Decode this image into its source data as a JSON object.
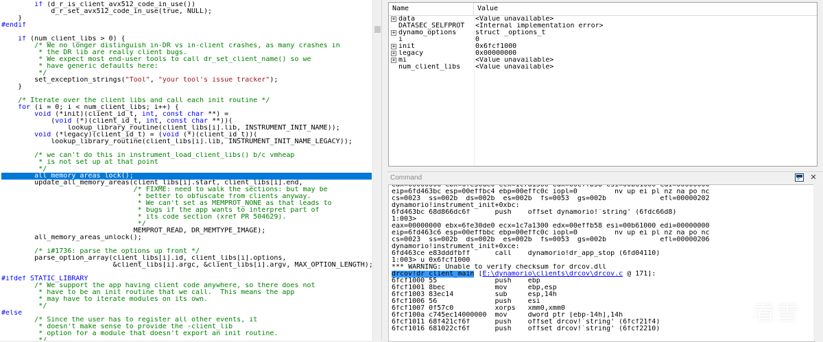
{
  "source": {
    "highlighted_line": 25,
    "lines": [
      [
        {
          "t": "        ",
          "c": "plain"
        },
        {
          "t": "if",
          "c": "kw"
        },
        {
          "t": " (d_r_is_client_avx512_code_in_use())",
          "c": "plain"
        }
      ],
      [
        {
          "t": "            d_r_set_avx512_code_in_use(true, NULL);",
          "c": "plain"
        }
      ],
      [
        {
          "t": "    }",
          "c": "plain"
        }
      ],
      [
        {
          "t": "#endif",
          "c": "pp"
        }
      ],
      [
        {
          "t": "",
          "c": "plain"
        }
      ],
      [
        {
          "t": "    ",
          "c": "plain"
        },
        {
          "t": "if",
          "c": "kw"
        },
        {
          "t": " (num_client_libs > 0) {",
          "c": "plain"
        }
      ],
      [
        {
          "t": "        /* We no longer distinguish in-DR vs in-client crashes, as many crashes in",
          "c": "com"
        }
      ],
      [
        {
          "t": "         * the DR lib are really client bugs.",
          "c": "com"
        }
      ],
      [
        {
          "t": "         * We expect most end-user tools to call dr_set_client_name() so we",
          "c": "com"
        }
      ],
      [
        {
          "t": "         * have generic defaults here:",
          "c": "com"
        }
      ],
      [
        {
          "t": "         */",
          "c": "com"
        }
      ],
      [
        {
          "t": "        set_exception_strings(",
          "c": "plain"
        },
        {
          "t": "\"Tool\"",
          "c": "str"
        },
        {
          "t": ", ",
          "c": "plain"
        },
        {
          "t": "\"your tool's issue tracker\"",
          "c": "str"
        },
        {
          "t": ");",
          "c": "plain"
        }
      ],
      [
        {
          "t": "    }",
          "c": "plain"
        }
      ],
      [
        {
          "t": "",
          "c": "plain"
        }
      ],
      [
        {
          "t": "    /* Iterate over the client libs and call each init routine */",
          "c": "com"
        }
      ],
      [
        {
          "t": "    ",
          "c": "plain"
        },
        {
          "t": "for",
          "c": "kw"
        },
        {
          "t": " (i = 0; i < num_client_libs; i++) {",
          "c": "plain"
        }
      ],
      [
        {
          "t": "        ",
          "c": "plain"
        },
        {
          "t": "void",
          "c": "kw"
        },
        {
          "t": " (*init)(client_id_t, ",
          "c": "plain"
        },
        {
          "t": "int",
          "c": "kw"
        },
        {
          "t": ", ",
          "c": "plain"
        },
        {
          "t": "const char",
          "c": "kw"
        },
        {
          "t": " **) =",
          "c": "plain"
        }
      ],
      [
        {
          "t": "            (",
          "c": "plain"
        },
        {
          "t": "void",
          "c": "kw"
        },
        {
          "t": " (*)(client_id_t, ",
          "c": "plain"
        },
        {
          "t": "int",
          "c": "kw"
        },
        {
          "t": ", ",
          "c": "plain"
        },
        {
          "t": "const char",
          "c": "kw"
        },
        {
          "t": " **))(",
          "c": "plain"
        }
      ],
      [
        {
          "t": "                lookup_library_routine(client_libs[i].lib, INSTRUMENT_INIT_NAME));",
          "c": "plain"
        }
      ],
      [
        {
          "t": "        ",
          "c": "plain"
        },
        {
          "t": "void",
          "c": "kw"
        },
        {
          "t": " (*legacy)(client_id_t) = (",
          "c": "plain"
        },
        {
          "t": "void",
          "c": "kw"
        },
        {
          "t": " (*)(client_id_t))(",
          "c": "plain"
        }
      ],
      [
        {
          "t": "            lookup_library_routine(client_libs[i].lib, INSTRUMENT_INIT_NAME_LEGACY));",
          "c": "plain"
        }
      ],
      [
        {
          "t": "",
          "c": "plain"
        }
      ],
      [
        {
          "t": "        /* we can't do this in instrument_load_client_libs() b/c vmheap",
          "c": "com"
        }
      ],
      [
        {
          "t": "         * is not set up at that point",
          "c": "com"
        }
      ],
      [
        {
          "t": "         */",
          "c": "com"
        }
      ],
      [
        {
          "t": "        all_memory_areas_lock();",
          "c": "plain"
        }
      ],
      [
        {
          "t": "        update_all_memory_areas(client_libs[i].start, client_libs[i].end,",
          "c": "plain"
        }
      ],
      [
        {
          "t": "                                /* FIXME: need to walk the sections: but may be",
          "c": "com"
        }
      ],
      [
        {
          "t": "                                 * better to obfuscate from clients anyway.",
          "c": "com"
        }
      ],
      [
        {
          "t": "                                 * We can't set as MEMPROT_NONE as that leads to",
          "c": "com"
        }
      ],
      [
        {
          "t": "                                 * bugs if the app wants to interpret part of",
          "c": "com"
        }
      ],
      [
        {
          "t": "                                 * its code section (xref PR 504629).",
          "c": "com"
        }
      ],
      [
        {
          "t": "                                 */",
          "c": "com"
        }
      ],
      [
        {
          "t": "                                MEMPROT_READ, DR_MEMTYPE_IMAGE);",
          "c": "plain"
        }
      ],
      [
        {
          "t": "        all_memory_areas_unlock();",
          "c": "plain"
        }
      ],
      [
        {
          "t": "",
          "c": "plain"
        }
      ],
      [
        {
          "t": "        /* i#1736: parse the options up front */",
          "c": "com"
        }
      ],
      [
        {
          "t": "        parse_option_array(client_libs[i].id, client_libs[i].options,",
          "c": "plain"
        }
      ],
      [
        {
          "t": "                           &client_libs[i].argc, &client_libs[i].argv, MAX_OPTION_LENGTH);",
          "c": "plain"
        }
      ],
      [
        {
          "t": "",
          "c": "plain"
        }
      ],
      [
        {
          "t": "#ifdef STATIC_LIBRARY",
          "c": "pp"
        }
      ],
      [
        {
          "t": "        /* We support the app having client code anywhere, so there does not",
          "c": "com"
        }
      ],
      [
        {
          "t": "         * have to be an init routine that we call.  This means the app",
          "c": "com"
        }
      ],
      [
        {
          "t": "         * may have to iterate modules on its own.",
          "c": "com"
        }
      ],
      [
        {
          "t": "         */",
          "c": "com"
        }
      ],
      [
        {
          "t": "#else",
          "c": "pp"
        }
      ],
      [
        {
          "t": "        /* Since the user has to register all other events, it",
          "c": "com"
        }
      ],
      [
        {
          "t": "         * doesn't make sense to provide the -client_lib",
          "c": "com"
        }
      ],
      [
        {
          "t": "         * option for a module that doesn't export an init routine.",
          "c": "com"
        }
      ],
      [
        {
          "t": "         */",
          "c": "com"
        }
      ]
    ]
  },
  "watch": {
    "header_name": "Name",
    "header_value": "Value",
    "rows": [
      {
        "expand": "+",
        "name": "data",
        "value": "<Value unavailable>"
      },
      {
        "expand": "",
        "name": "DATASEC_SELFPROT",
        "value": "<Internal implementation error>"
      },
      {
        "expand": "+",
        "name": "dynamo_options",
        "value": "struct _options_t"
      },
      {
        "expand": "",
        "name": "i",
        "value": "0"
      },
      {
        "expand": "+",
        "name": "init",
        "value": "0x6fcf1000"
      },
      {
        "expand": "+",
        "name": "legacy",
        "value": "0x00000000"
      },
      {
        "expand": "+",
        "name": "mi",
        "value": "<Value unavailable>"
      },
      {
        "expand": "",
        "name": "num_client_libs",
        "value": "<Value unavailable>"
      }
    ]
  },
  "command": {
    "title": "Command",
    "icon": "console-icon",
    "lines": [
      [
        {
          "t": "eax=00000000 ebx=6fe30de0 ecx=1c7a1300 edx=00effb58 esi=00b61000 edi=00000000"
        }
      ],
      [
        {
          "t": "eip=6fd463bc esp=00effbc4 ebp=00effc0c iopl=0         nv up ei pl nz na po nc"
        }
      ],
      [
        {
          "t": "cs=0023  ss=002b  ds=002b  es=002b  fs=0053  gs=002b             efl=00000202"
        }
      ],
      [
        {
          "t": "dynamorio!instrument_init+0xbc:"
        }
      ],
      [
        {
          "t": "6fd463bc 68d866dc6f      push    offset dynamorio!`string' (6fdc66d8)"
        }
      ],
      [
        {
          "t": "1:003>"
        }
      ],
      [
        {
          "t": "eax=00000000 ebx=6fe30de0 ecx=1c7a1300 edx=00effb58 esi=00b61000 edi=00000000"
        }
      ],
      [
        {
          "t": "eip=6fd463c6 esp=00effbbc ebp=00effc0c iopl=0         nv up ei pl nz na po nc"
        }
      ],
      [
        {
          "t": "cs=0023  ss=002b  ds=002b  es=002b  fs=0053  gs=002b             efl=00000206"
        }
      ],
      [
        {
          "t": "dynamorio!instrument_init+0xce:"
        }
      ],
      [
        {
          "t": "6fd463ce e83dddfbff      call    dynamorio!dr_app_stop (6fd04110)"
        }
      ],
      [
        {
          "t": "1:003> u 0x6fcf1000"
        }
      ],
      [
        {
          "t": "*** WARNING: Unable to verify checksum for drcov.dll"
        }
      ],
      [
        {
          "t": "drcov!dr_client_main",
          "k": "sel"
        },
        {
          "t": " ["
        },
        {
          "t": "E:\\dynamorio\\clients\\drcov\\drcov.c",
          "k": "link"
        },
        {
          "t": " @ 171]:"
        }
      ],
      [
        {
          "t": "6fcf1000 55              push    ebp"
        }
      ],
      [
        {
          "t": "6fcf1001 8bec            mov     ebp,esp"
        }
      ],
      [
        {
          "t": "6fcf1003 83ec14          sub     esp,14h"
        }
      ],
      [
        {
          "t": "6fcf1006 56              push    esi"
        }
      ],
      [
        {
          "t": "6fcf1007 0f57c0          xorps   xmm0,xmm0"
        }
      ],
      [
        {
          "t": "6fcf100a c745ec14000000  mov     dword ptr [ebp-14h],14h"
        }
      ],
      [
        {
          "t": "6fcf1011 68f421cf6f      push    offset drcov!`string' (6fcf21f4)"
        }
      ],
      [
        {
          "t": "6fcf1016 681022cf6f      push    offset drcov!`string' (6fcf2210)"
        }
      ]
    ]
  },
  "watermark": {
    "text": "看雪",
    "icon": "snowflake-icon"
  },
  "colors": {
    "comment": "#008000",
    "keyword": "#0000ff",
    "string": "#a31515",
    "selection": "#0078d7",
    "link": "#0000ff"
  }
}
